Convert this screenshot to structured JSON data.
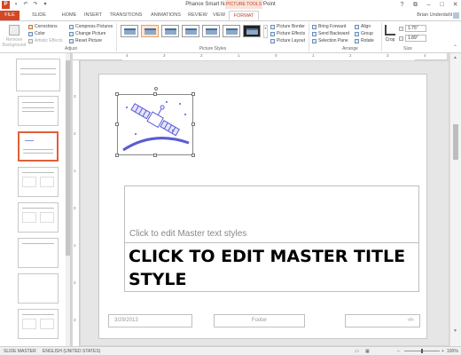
{
  "app": {
    "title": "Phanox Smart Navigator - PowerPoint",
    "tools_tag": "PICTURE TOOLS",
    "user": "Brian Underdahl"
  },
  "qat": {
    "logo": "P",
    "save": "▪",
    "undo": "↶",
    "redo": "↷",
    "customize": "▾"
  },
  "window_controls": {
    "help": "?",
    "restore": "⧉",
    "minimize": "–",
    "maximize": "□",
    "close": "✕"
  },
  "tabs": [
    "FILE",
    "SLIDE MASTER",
    "HOME",
    "INSERT",
    "TRANSITIONS",
    "ANIMATIONS",
    "REVIEW",
    "VIEW",
    "FORMAT"
  ],
  "ribbon": {
    "remove_bg": "Remove Background",
    "adjust": {
      "corrections": "Corrections",
      "color": "Color",
      "artistic": "Artistic Effects",
      "compress": "Compress Pictures",
      "change": "Change Picture",
      "reset": "Reset Picture",
      "label": "Adjust"
    },
    "styles": {
      "border": "Picture Border",
      "effects": "Picture Effects",
      "layout": "Picture Layout",
      "label": "Picture Styles"
    },
    "arrange": {
      "forward": "Bring Forward",
      "backward": "Send Backward",
      "pane": "Selection Pane",
      "align": "Align",
      "group": "Group",
      "rotate": "Rotate",
      "label": "Arrange"
    },
    "size": {
      "crop": "Crop",
      "height": "1.75\"",
      "width": "1.89\"",
      "label": "Size"
    }
  },
  "ruler": {
    "h": [
      "4",
      "3",
      "2",
      "1",
      "0",
      "1",
      "2",
      "3",
      "4"
    ],
    "v": [
      "3",
      "2",
      "1",
      "0",
      "1",
      "2",
      "3"
    ]
  },
  "slide": {
    "body_hint": "Click to edit Master text styles",
    "title": "CLICK TO EDIT MASTER TITLE STYLE",
    "date": "3/29/2013",
    "footer": "Footer",
    "number": "‹#›"
  },
  "status": {
    "view": "SLIDE MASTER",
    "language": "ENGLISH (UNITED STATES)",
    "zoom": "100%"
  }
}
